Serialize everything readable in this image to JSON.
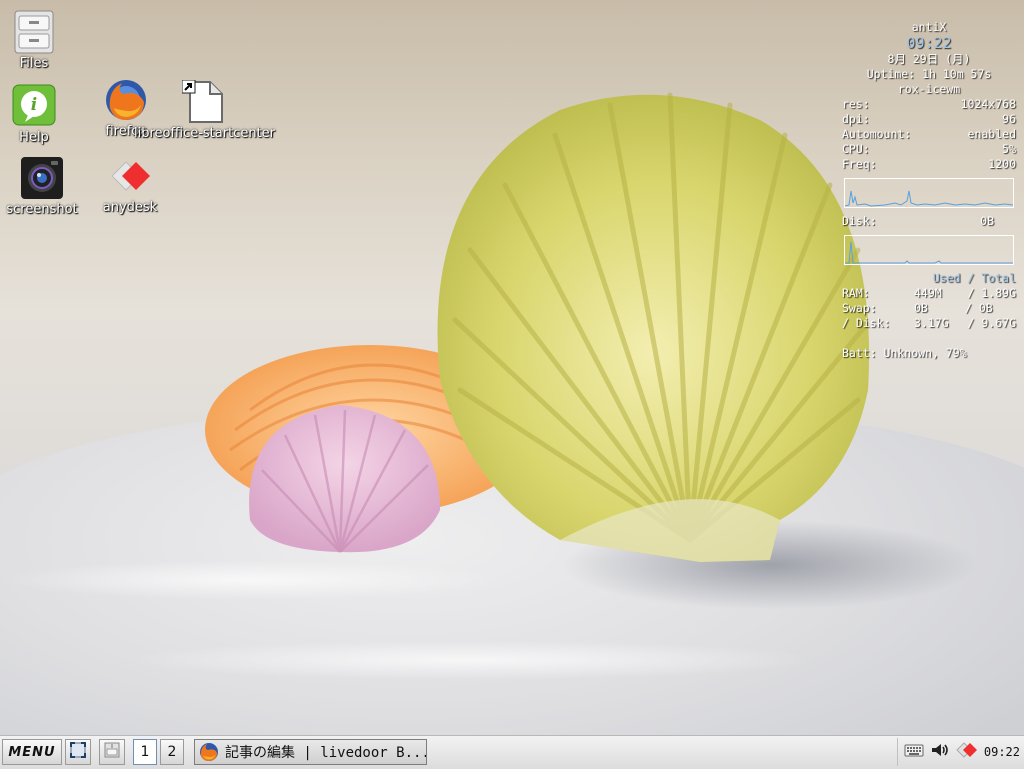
{
  "desktop": {
    "icons": [
      {
        "label": "Files",
        "icon": "file-cabinet-icon"
      },
      {
        "label": "Help",
        "icon": "info-bubble-icon"
      },
      {
        "label": "firefox",
        "icon": "firefox-icon"
      },
      {
        "label": "libreoffice-startcenter",
        "icon": "libreoffice-icon"
      },
      {
        "label": "screenshot",
        "icon": "camera-icon"
      },
      {
        "label": "anydesk",
        "icon": "anydesk-icon"
      }
    ]
  },
  "conky": {
    "title": "antiX",
    "time": "09:22",
    "date": "8月 29日 (月)",
    "uptime": "Uptime: 1h 10m 57s",
    "wm": "rox-icewm",
    "stats": [
      {
        "label": "res:",
        "value": "1024x768"
      },
      {
        "label": "dpi:",
        "value": "96"
      },
      {
        "label": "Automount:",
        "value": "enabled"
      },
      {
        "label": "CPU:",
        "value": "5%"
      },
      {
        "label": "Freq:",
        "value": "1200"
      }
    ],
    "disk_label": "Disk:",
    "disk_value": "0B",
    "used_total_header": "Used / Total",
    "mem": [
      {
        "label": "RAM:",
        "used": "449M",
        "total": "/ 1.89G"
      },
      {
        "label": "Swap:",
        "used": "0B",
        "total": "/ 0B"
      },
      {
        "label": "/ Disk:",
        "used": "3.17G",
        "total": "/ 9.67G"
      }
    ],
    "battery": "Batt: Unknown, 79%",
    "accent_color": "#9ec4e6"
  },
  "taskbar": {
    "menu_label": "MENU",
    "workspaces": [
      "1",
      "2"
    ],
    "active_workspace": "1",
    "task_title": "記事の編集 | livedoor B...",
    "clock": "09:22",
    "tray_icons": [
      "keyboard-icon",
      "volume-icon",
      "anydesk-tray-icon"
    ]
  }
}
